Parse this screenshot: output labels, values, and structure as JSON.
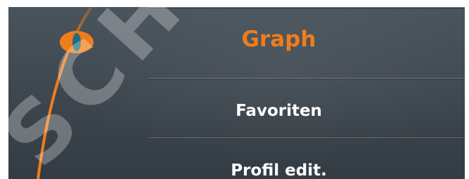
{
  "menu": {
    "items": [
      {
        "label": "Graph",
        "selected": true
      },
      {
        "label": "Favoriten",
        "selected": false
      },
      {
        "label": "Profil edit.",
        "selected": false
      }
    ]
  },
  "watermark": {
    "text": "SCH"
  },
  "colors": {
    "accent": "#f07d1a",
    "selected_text": "#f07d1a",
    "text": "#ffffff",
    "background": "#3f4850"
  },
  "icons": {
    "selection_indicator": "eye-marker-icon"
  }
}
